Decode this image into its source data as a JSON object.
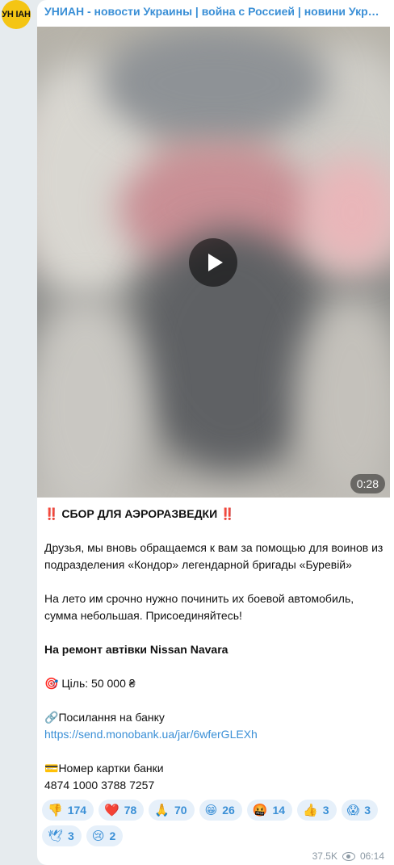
{
  "channel": {
    "name": "УНИАН - новости Украины | война с Россией | новини України...",
    "avatar_text": "УН ІАН"
  },
  "video": {
    "duration": "0:28",
    "icon": "play-icon"
  },
  "message": {
    "title_marker_left": "‼️",
    "title": "СБОР ДЛЯ АЭРОРАЗВЕДКИ",
    "title_marker_right": "‼️",
    "para1": "Друзья, мы вновь обращаемся к вам за помощью для воинов из подразделения «Кондор» легендарной бригады «Буревій»",
    "para2": "На лето им срочно нужно починить их боевой автомобиль, сумма небольшая. Присоединяйтесь!",
    "repair": "На ремонт автівки Nissan Navara",
    "goal_icon": "🎯",
    "goal": "Ціль: 50 000 ₴",
    "bank_link_icon": "🔗",
    "bank_link_label": "Посилання на банку",
    "bank_url": "https://send.monobank.ua/jar/6wferGLEXh",
    "card_icon": "💳",
    "card_label": "Номер картки банки",
    "card_number": "4874 1000 3788 7257"
  },
  "reactions": [
    {
      "emoji": "👎",
      "count": "174"
    },
    {
      "emoji": "❤️",
      "count": "78"
    },
    {
      "emoji": "🙏",
      "count": "70"
    },
    {
      "emoji": "😁",
      "count": "26"
    },
    {
      "emoji": "🤬",
      "count": "14"
    },
    {
      "emoji": "👍",
      "count": "3"
    },
    {
      "emoji": "😱",
      "count": "3"
    },
    {
      "emoji": "🕊",
      "count": "3"
    },
    {
      "emoji": "😢",
      "count": "2"
    }
  ],
  "footer": {
    "views": "37.5K",
    "time": "06:14"
  },
  "colors": {
    "accent": "#3a8fd6",
    "background": "#e6ebee",
    "reaction_bg": "#e6f0fa"
  }
}
